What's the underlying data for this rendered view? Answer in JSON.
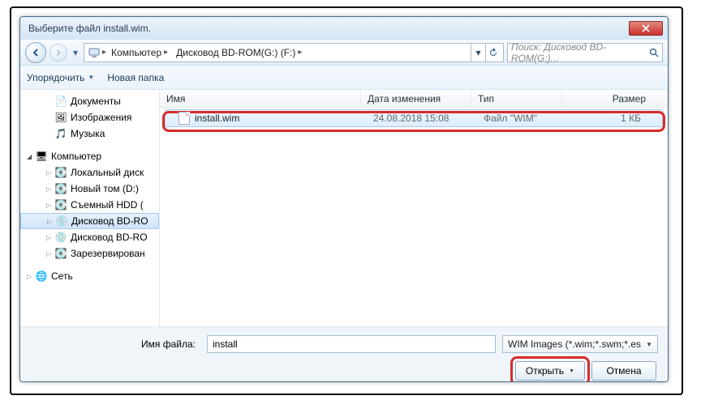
{
  "title": "Выберите файл install.wim.",
  "nav": {
    "breadcrumb": [
      {
        "label": "Компьютер"
      },
      {
        "label": "Дисковод BD-ROM(G:) (F:)"
      }
    ],
    "search_placeholder": "Поиск: Дисковод BD-ROM(G:)..."
  },
  "toolbar": {
    "organize": "Упорядочить",
    "newfolder": "Новая папка"
  },
  "tree": {
    "libs": [
      {
        "name": "Документы",
        "icon": "📄"
      },
      {
        "name": "Изображения",
        "icon": "🖼"
      },
      {
        "name": "Музыка",
        "icon": "🎵"
      }
    ],
    "computer_label": "Компьютер",
    "drives": [
      {
        "name": "Локальный диск",
        "icon": "💽"
      },
      {
        "name": "Новый том (D:)",
        "icon": "💽"
      },
      {
        "name": "Съемный HDD (",
        "icon": "💽"
      },
      {
        "name": "Дисковод BD-RO",
        "icon": "💿",
        "selected": true
      },
      {
        "name": "Дисковод BD-RO",
        "icon": "💿"
      },
      {
        "name": "Зарезервирован",
        "icon": "💽"
      }
    ],
    "network_label": "Сеть"
  },
  "columns": {
    "name": "Имя",
    "date": "Дата изменения",
    "type": "Тип",
    "size": "Размер"
  },
  "files": [
    {
      "name": "install.wim",
      "date": "24.08.2018 15:08",
      "type": "Файл \"WIM\"",
      "size": "1 КБ"
    }
  ],
  "bottom": {
    "filename_label": "Имя файла:",
    "filename_value": "install",
    "filter": "WIM Images (*.wim;*.swm;*.es",
    "open": "Открыть",
    "cancel": "Отмена"
  }
}
